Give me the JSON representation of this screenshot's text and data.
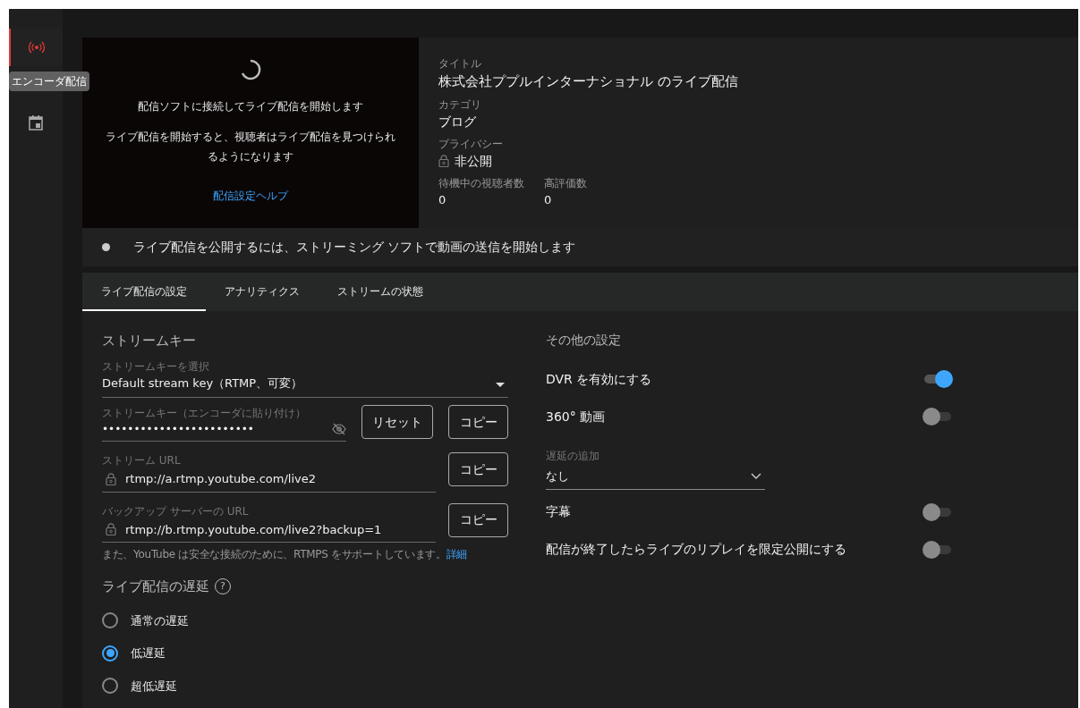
{
  "sidebar": {
    "items": [
      {
        "kind": "live",
        "selected": true
      },
      {
        "kind": "calendar",
        "selected": false
      }
    ],
    "tooltip": "エンコーダ配信"
  },
  "preview": {
    "message": "配信ソフトに接続してライブ配信を開始します",
    "description": "ライブ配信を開始すると、視聴者はライブ配信を見つけられるようになります",
    "help_link": "配信設定ヘルプ"
  },
  "details": {
    "fields": [
      {
        "label": "タイトル",
        "value": "株式会社ププルインターナショナル のライブ配信",
        "locked": false
      },
      {
        "label": "カテゴリ",
        "value": "ブログ",
        "locked": false
      },
      {
        "label": "プライバシー",
        "value": "非公開",
        "locked": true
      }
    ],
    "stats": [
      {
        "label": "待機中の視聴者数",
        "value": "0"
      },
      {
        "label": "高評価数",
        "value": "0"
      }
    ]
  },
  "status_banner": "ライブ配信を公開するには、ストリーミング ソフトで動画の送信を開始します",
  "tabs": [
    {
      "label": "ライブ配信の設定",
      "selected": true
    },
    {
      "label": "アナリティクス",
      "selected": false
    },
    {
      "label": "ストリームの状態",
      "selected": false
    }
  ],
  "stream_key": {
    "heading": "ストリームキー",
    "select": {
      "label": "ストリームキーを選択",
      "value": "Default stream key（RTMP、可変）"
    },
    "key_field": {
      "label": "ストリームキー（エンコーダに貼り付け）",
      "value": "••••••••••••••••••••••••",
      "reset": "リセット",
      "copy": "コピー"
    },
    "url_fields": [
      {
        "label": "ストリーム URL",
        "value": "rtmp://a.rtmp.youtube.com/live2",
        "copy": "コピー"
      },
      {
        "label": "バックアップ サーバーの URL",
        "value": "rtmp://b.rtmp.youtube.com/live2?backup=1",
        "copy": "コピー"
      }
    ],
    "note": "また、YouTube は安全な接続のために、RTMPS をサポートしています。",
    "note_link": "詳細"
  },
  "latency": {
    "heading": "ライブ配信の遅延",
    "help": "?",
    "options": [
      {
        "label": "通常の遅延",
        "selected": false
      },
      {
        "label": "低遅延",
        "selected": true
      },
      {
        "label": "超低遅延",
        "selected": false
      }
    ]
  },
  "other_settings": {
    "heading": "その他の設定",
    "items": [
      {
        "kind": "toggle",
        "label": "DVR を有効にする",
        "on": true
      },
      {
        "kind": "toggle",
        "label": "360° 動画",
        "on": false
      },
      {
        "kind": "select",
        "label": "遅延の追加",
        "value": "なし"
      },
      {
        "kind": "toggle",
        "label": "字幕",
        "on": false
      },
      {
        "kind": "toggle",
        "label": "配信が終了したらライブのリプレイを限定公開にする",
        "on": false
      }
    ]
  }
}
